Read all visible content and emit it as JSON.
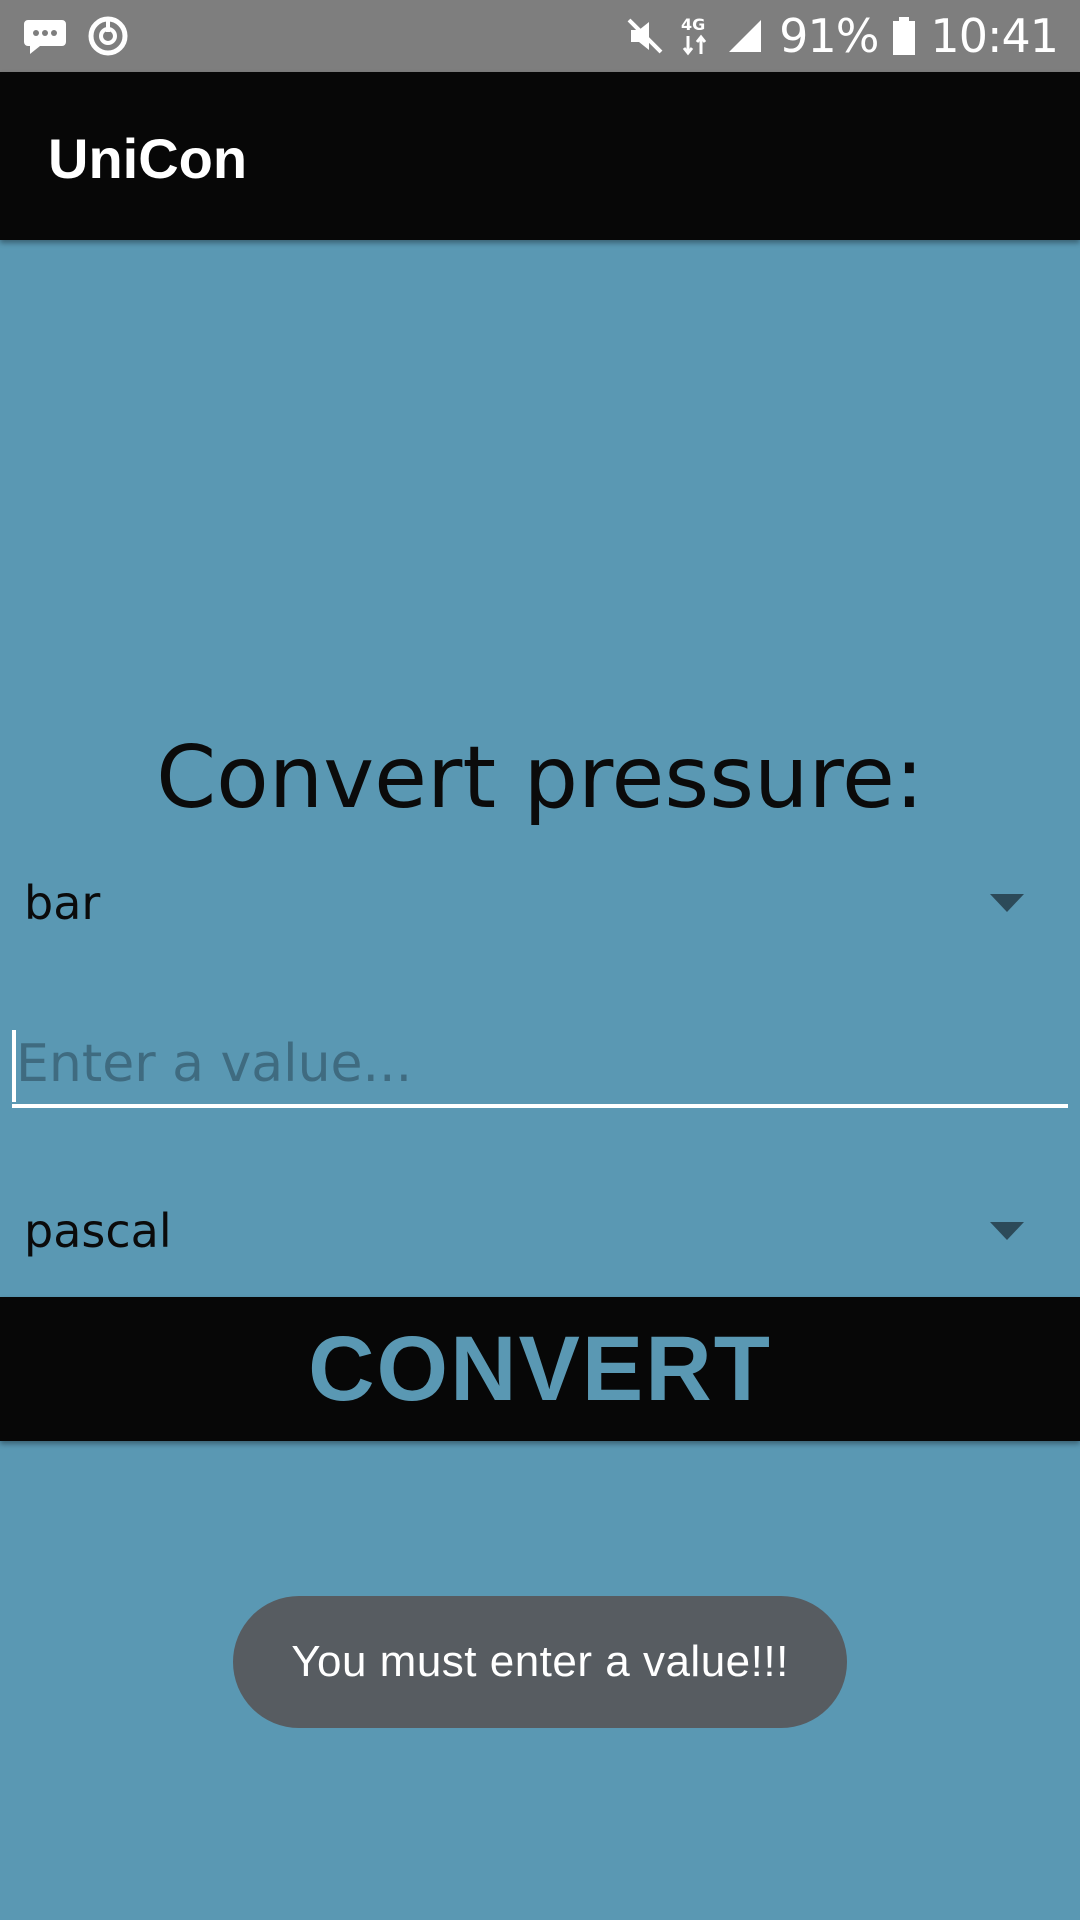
{
  "status_bar": {
    "battery": "91%",
    "time": "10:41",
    "network_label": "4G",
    "icons": [
      "message-icon",
      "sync-icon",
      "mute-icon",
      "data-4g-icon",
      "signal-icon",
      "battery-icon"
    ]
  },
  "app_bar": {
    "title": "UniCon"
  },
  "main": {
    "heading": "Convert pressure:",
    "from_unit": "bar",
    "value_placeholder": "Enter a value...",
    "to_unit": "pascal",
    "convert_label": "CONVERT"
  },
  "toast": {
    "message": "You must enter a value!!!"
  },
  "colors": {
    "background": "#5a98b3",
    "app_bar": "#070707",
    "status_bar": "#7e7e7e",
    "toast": "#575c61"
  }
}
